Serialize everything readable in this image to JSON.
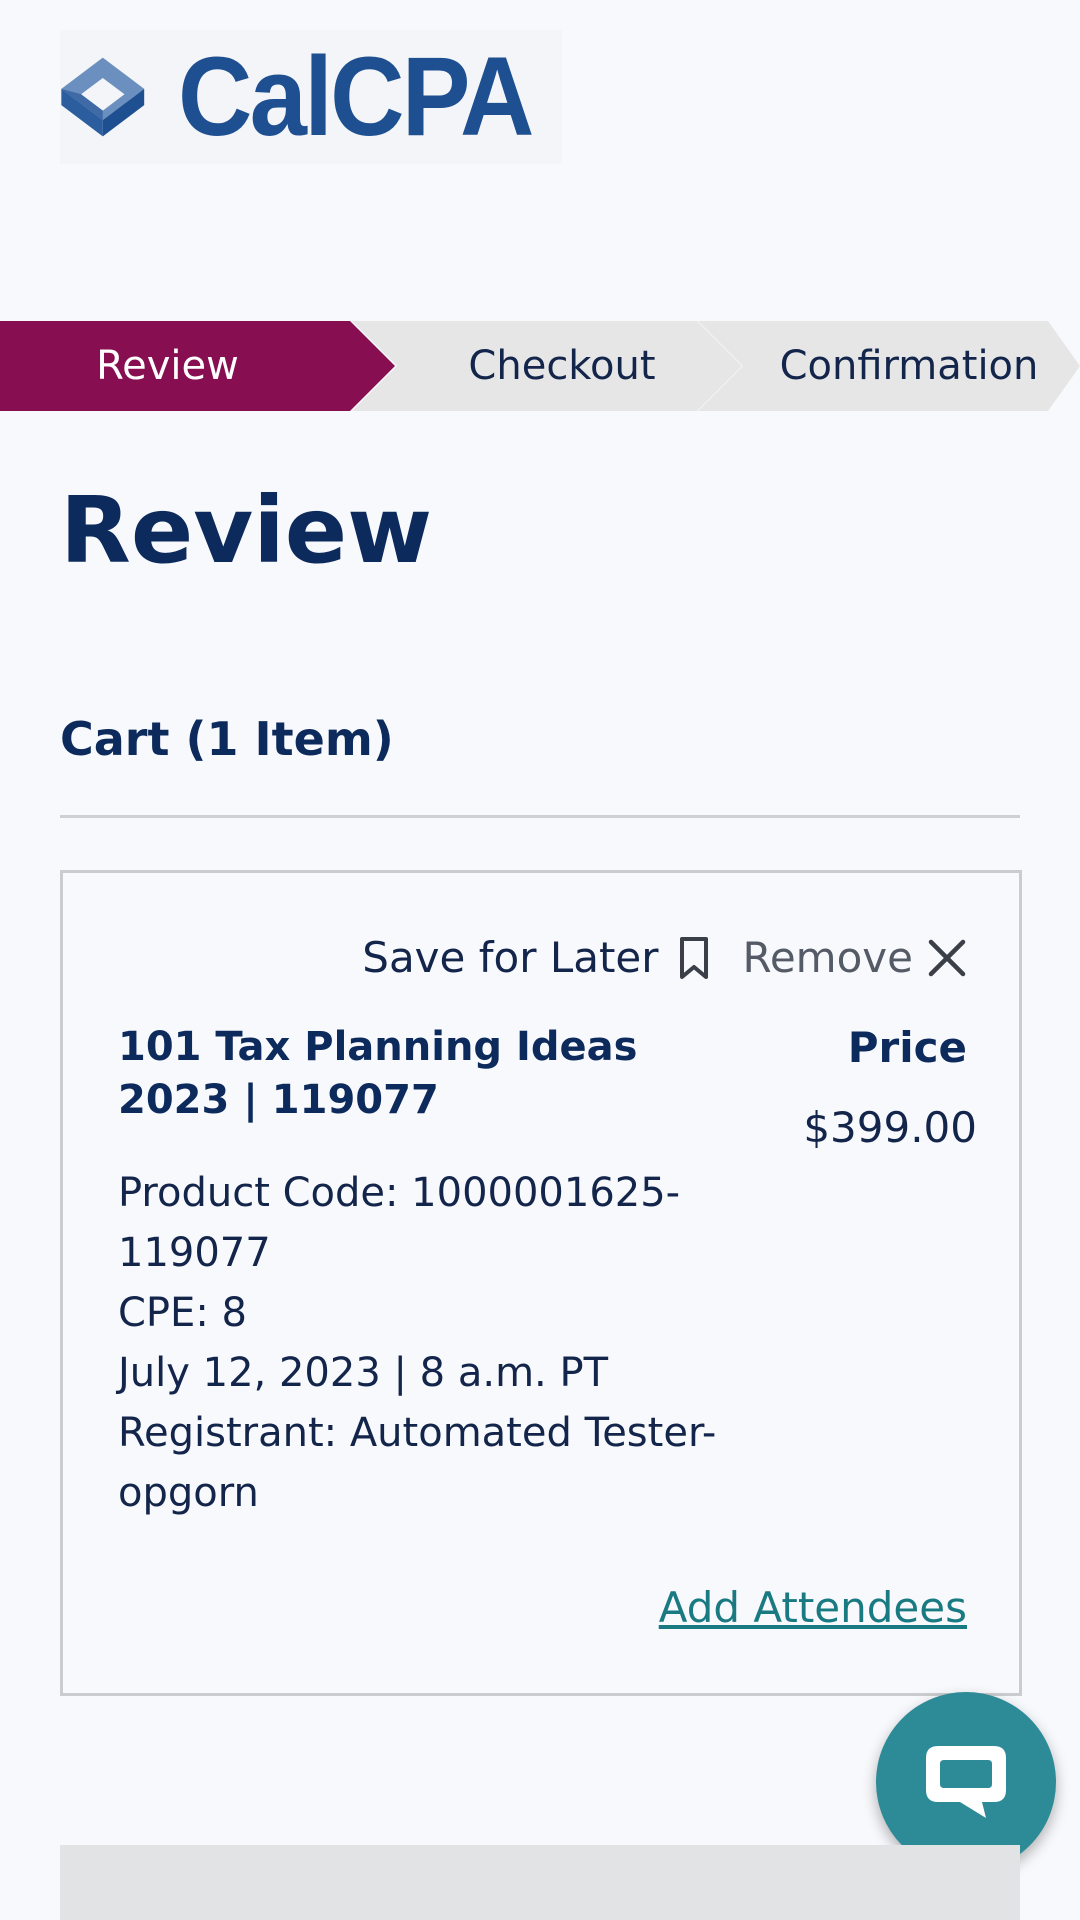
{
  "logo": {
    "text": "CalCPA",
    "icon": "calcpa-cube-logo-icon",
    "color": "#1d4f91"
  },
  "steps": [
    {
      "label": "Review",
      "active": true
    },
    {
      "label": "Checkout",
      "active": false
    },
    {
      "label": "Confirmation",
      "active": false
    }
  ],
  "page": {
    "title": "Review",
    "cart_heading": "Cart (1 Item)"
  },
  "cart_item": {
    "save_for_later_label": "Save for Later",
    "save_icon": "bookmark-icon",
    "remove_label": "Remove",
    "remove_icon": "close-icon",
    "title": "101 Tax Planning Ideas 2023 | 119077",
    "details": {
      "product_code": "Product Code: 1000001625-119077",
      "cpe": "CPE: 8",
      "date": "July 12, 2023 | 8 a.m. PT",
      "registrant": "Registrant: Automated Tester-opgorn"
    },
    "price_label": "Price",
    "price_value": "$399.00",
    "add_attendees_label": "Add Attendees"
  },
  "chat": {
    "icon": "chat-bubble-icon"
  },
  "colors": {
    "accent": "#870e50",
    "heading": "#0c2a5c",
    "link": "#1a7a82",
    "chat": "#2d8a97"
  }
}
